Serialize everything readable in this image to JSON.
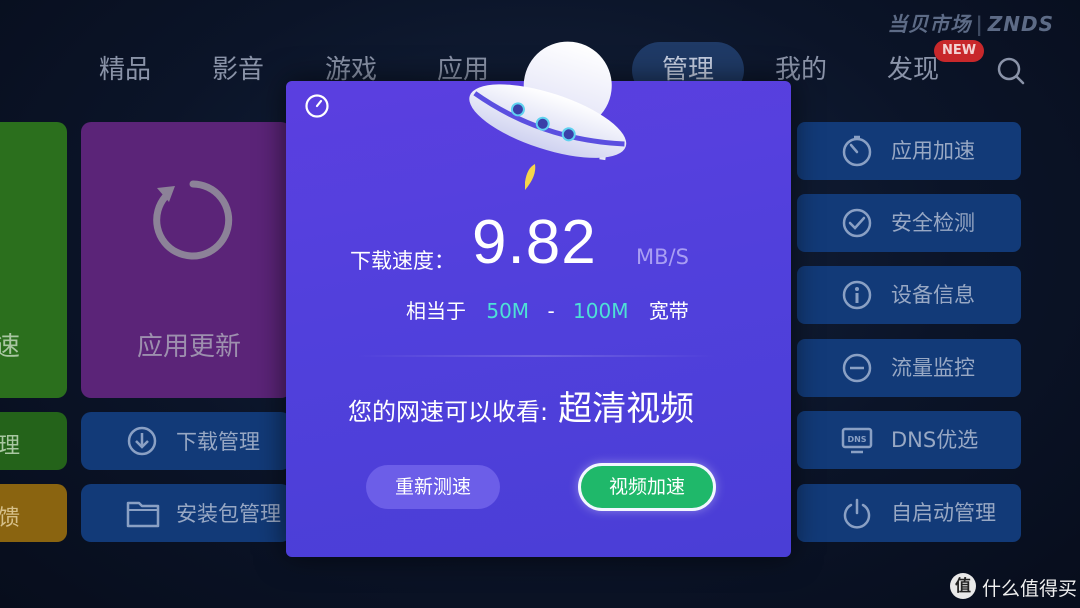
{
  "brand": {
    "name": "当贝市场",
    "logo": "ZNDS"
  },
  "nav": {
    "items": [
      {
        "label": "精品"
      },
      {
        "label": "影音"
      },
      {
        "label": "游戏"
      },
      {
        "label": "应用"
      },
      {
        "label": "管理"
      },
      {
        "label": "我的"
      },
      {
        "label": "发现"
      }
    ],
    "active": "管理",
    "badge": "NEW",
    "search_icon": "search-icon"
  },
  "left": {
    "partial_top": "速",
    "partial_mid": "理",
    "partial_bottom": "馈",
    "app_update": "应用更新",
    "download_manage": "下载管理",
    "package_manage": "安装包管理"
  },
  "right": {
    "items": [
      {
        "label": "应用加速",
        "icon": "speedometer-icon"
      },
      {
        "label": "安全检测",
        "icon": "check-circle-icon"
      },
      {
        "label": "设备信息",
        "icon": "info-icon"
      },
      {
        "label": "流量监控",
        "icon": "minus-circle-icon"
      },
      {
        "label": "DNS优选",
        "icon": "dns-icon"
      },
      {
        "label": "自启动管理",
        "icon": "power-icon"
      }
    ]
  },
  "dialog": {
    "speed_label": "下载速度：",
    "speed_value": "9.82",
    "speed_unit": "MB/S",
    "equiv_prefix": "相当于",
    "equiv_low": "50M",
    "equiv_dash": "-",
    "equiv_high": "100M",
    "equiv_suffix": "宽带",
    "watch_prefix": "您的网速可以收看:",
    "watch_quality": "超清视频",
    "retest_button": "重新测速",
    "accelerate_button": "视频加速"
  },
  "watermark": {
    "icon": "值",
    "text": "什么值得买"
  },
  "colors": {
    "dialog_bg": "#5344dc",
    "accent_cyan": "#4ee0d6",
    "accel_green": "#1fb86a",
    "tile_purple": "#6d2a8c",
    "tile_green": "#2f7d1f",
    "tile_blue": "#123a78"
  }
}
